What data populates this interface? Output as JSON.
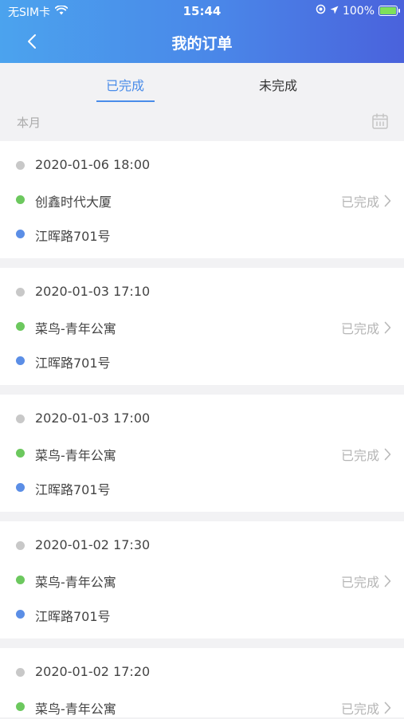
{
  "status_bar": {
    "carrier": "无SIM卡",
    "time": "15:44",
    "battery": "100%"
  },
  "nav": {
    "title": "我的订单"
  },
  "tabs": [
    {
      "label": "已完成",
      "active": true
    },
    {
      "label": "未完成",
      "active": false
    }
  ],
  "month": {
    "label": "本月"
  },
  "orders": [
    {
      "datetime": "2020-01-06 18:00",
      "from": "创鑫时代大厦",
      "to": "江晖路701号",
      "status": "已完成"
    },
    {
      "datetime": "2020-01-03 17:10",
      "from": "菜鸟-青年公寓",
      "to": "江晖路701号",
      "status": "已完成"
    },
    {
      "datetime": "2020-01-03 17:00",
      "from": "菜鸟-青年公寓",
      "to": "江晖路701号",
      "status": "已完成"
    },
    {
      "datetime": "2020-01-02 17:30",
      "from": "菜鸟-青年公寓",
      "to": "江晖路701号",
      "status": "已完成"
    },
    {
      "datetime": "2020-01-02 17:20",
      "from": "菜鸟-青年公寓",
      "to": "",
      "status": "已完成"
    }
  ],
  "colors": {
    "accent": "#4a8ce9",
    "header_gradient_start": "#4ba3ee",
    "header_gradient_end": "#4a62dc",
    "dot_time": "#c8c8c8",
    "dot_from": "#6cc85e",
    "dot_to": "#5b8ee6"
  }
}
